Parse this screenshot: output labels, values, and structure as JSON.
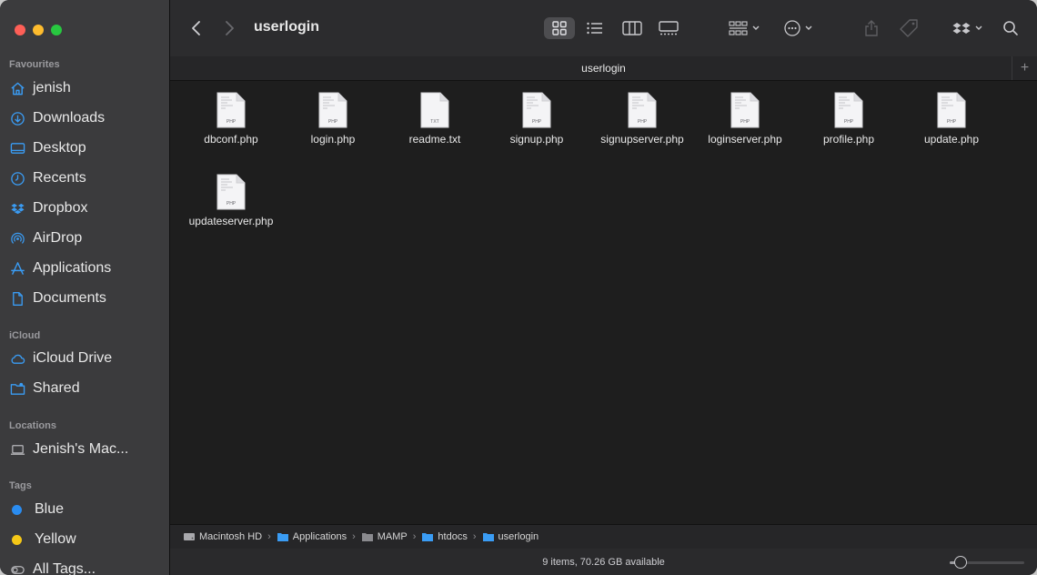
{
  "window": {
    "title": "userlogin",
    "tab_title": "userlogin"
  },
  "sidebar": {
    "favourites_heading": "Favourites",
    "favourites": [
      {
        "label": "jenish",
        "icon": "home-icon"
      },
      {
        "label": "Downloads",
        "icon": "downloads-icon"
      },
      {
        "label": "Desktop",
        "icon": "desktop-icon"
      },
      {
        "label": "Recents",
        "icon": "clock-icon"
      },
      {
        "label": "Dropbox",
        "icon": "dropbox-icon"
      },
      {
        "label": "AirDrop",
        "icon": "airdrop-icon"
      },
      {
        "label": "Applications",
        "icon": "applications-icon"
      },
      {
        "label": "Documents",
        "icon": "document-icon"
      }
    ],
    "icloud_heading": "iCloud",
    "icloud": [
      {
        "label": "iCloud Drive",
        "icon": "cloud-icon"
      },
      {
        "label": "Shared",
        "icon": "shared-folder-icon"
      }
    ],
    "locations_heading": "Locations",
    "locations": [
      {
        "label": "Jenish's Mac...",
        "icon": "laptop-icon"
      }
    ],
    "tags_heading": "Tags",
    "tags": [
      {
        "label": "Blue",
        "color": "#2a8cf0"
      },
      {
        "label": "Yellow",
        "color": "#f5c817"
      },
      {
        "label": "All Tags...",
        "icon": "tags-icon"
      }
    ]
  },
  "files": [
    {
      "name": "dbconf.php",
      "ext": "PHP"
    },
    {
      "name": "login.php",
      "ext": "PHP"
    },
    {
      "name": "readme.txt",
      "ext": "TXT"
    },
    {
      "name": "signup.php",
      "ext": "PHP"
    },
    {
      "name": "signupserver.php",
      "ext": "PHP"
    },
    {
      "name": "loginserver.php",
      "ext": "PHP"
    },
    {
      "name": "profile.php",
      "ext": "PHP"
    },
    {
      "name": "update.php",
      "ext": "PHP"
    },
    {
      "name": "updateserver.php",
      "ext": "PHP"
    }
  ],
  "path": [
    "Macintosh HD",
    "Applications",
    "MAMP",
    "htdocs",
    "userlogin"
  ],
  "status": {
    "text": "9 items, 70.26 GB available",
    "icon_size_level": 0.15
  },
  "colors": {
    "folder_blue": "#3a9cf4",
    "accent": "#2a8cf0"
  }
}
